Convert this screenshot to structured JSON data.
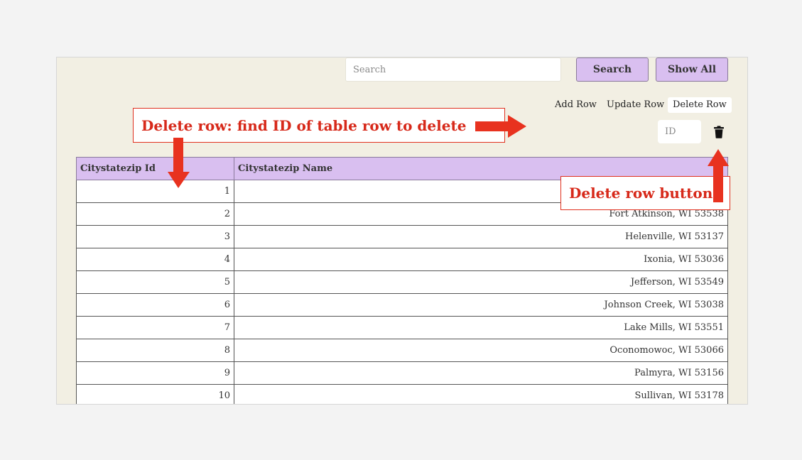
{
  "search": {
    "placeholder": "Search"
  },
  "toolbar": {
    "search_label": "Search",
    "show_all_label": "Show All"
  },
  "tabs": [
    {
      "label": "Add Row"
    },
    {
      "label": "Update Row"
    },
    {
      "label": "Delete Row",
      "active": true
    }
  ],
  "delete_form": {
    "id_placeholder": "ID",
    "delete_icon": "trash-icon"
  },
  "table": {
    "headers": [
      "Citystatezip Id",
      "Citystatezip Name"
    ],
    "rows": [
      {
        "id": "1",
        "name": ""
      },
      {
        "id": "2",
        "name": "Fort Atkinson, WI 53538"
      },
      {
        "id": "3",
        "name": "Helenville, WI 53137"
      },
      {
        "id": "4",
        "name": "Ixonia, WI 53036"
      },
      {
        "id": "5",
        "name": "Jefferson, WI 53549"
      },
      {
        "id": "6",
        "name": "Johnson Creek, WI 53038"
      },
      {
        "id": "7",
        "name": "Lake Mills, WI 53551"
      },
      {
        "id": "8",
        "name": "Oconomowoc, WI 53066"
      },
      {
        "id": "9",
        "name": "Palmyra, WI 53156"
      },
      {
        "id": "10",
        "name": "Sullivan, WI 53178"
      }
    ]
  },
  "annotations": {
    "find_id": "Delete row: find ID of table row to delete",
    "delete_button": "Delete row button"
  },
  "colors": {
    "accent": "#d9bff0",
    "panel": "#f2efe3",
    "annotation": "#e0301e"
  }
}
